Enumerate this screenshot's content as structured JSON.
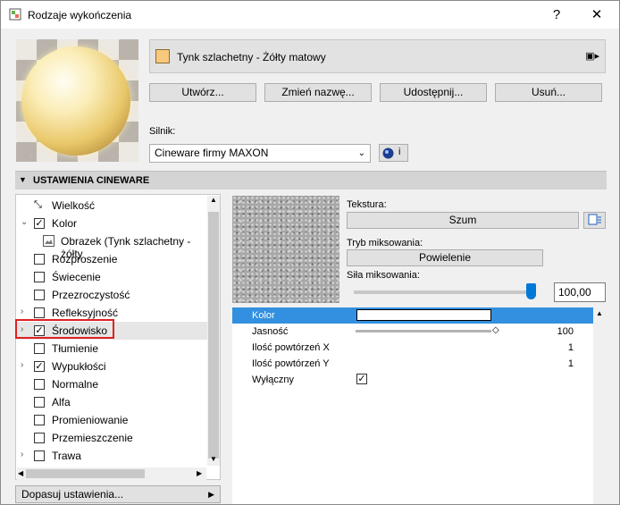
{
  "window": {
    "title": "Rodzaje wykończenia",
    "help": "?",
    "close": "✕"
  },
  "material": {
    "name": "Tynk szlachetny - Żółty matowy",
    "swatch_color": "#f8c97c"
  },
  "buttons": {
    "create": "Utwórz...",
    "rename": "Zmień nazwę...",
    "share": "Udostępnij...",
    "delete": "Usuń..."
  },
  "engine": {
    "label": "Silnik:",
    "value": "Cineware firmy MAXON",
    "info": "i"
  },
  "section": {
    "title": "USTAWIENIA CINEWARE"
  },
  "channels": [
    {
      "label": "Wielkość",
      "checked": null,
      "expand": ""
    },
    {
      "label": "Kolor",
      "checked": true,
      "expand": "⌄"
    },
    {
      "label": "Obrazek (Tynk szlachetny - żółty",
      "checked": null,
      "expand": ""
    },
    {
      "label": "Rozproszenie",
      "checked": false,
      "expand": ""
    },
    {
      "label": "Świecenie",
      "checked": false,
      "expand": ""
    },
    {
      "label": "Przezroczystość",
      "checked": false,
      "expand": ""
    },
    {
      "label": "Refleksyjność",
      "checked": false,
      "expand": "›"
    },
    {
      "label": "Środowisko",
      "checked": true,
      "expand": "›"
    },
    {
      "label": "Tłumienie",
      "checked": false,
      "expand": ""
    },
    {
      "label": "Wypukłości",
      "checked": true,
      "expand": "›"
    },
    {
      "label": "Normalne",
      "checked": false,
      "expand": ""
    },
    {
      "label": "Alfa",
      "checked": false,
      "expand": ""
    },
    {
      "label": "Promieniowanie",
      "checked": false,
      "expand": ""
    },
    {
      "label": "Przemieszczenie",
      "checked": false,
      "expand": ""
    },
    {
      "label": "Trawa",
      "checked": false,
      "expand": "›"
    }
  ],
  "footer": {
    "label": "Dopasuj ustawienia..."
  },
  "texture": {
    "label": "Tekstura:",
    "value": "Szum"
  },
  "blend": {
    "mode_label": "Tryb miksowania:",
    "mode_value": "Powielenie",
    "strength_label": "Siła miksowania:",
    "strength_value": "100,00"
  },
  "params": [
    {
      "label": "Kolor",
      "value": ""
    },
    {
      "label": "Jasność",
      "value": "100"
    },
    {
      "label": "Ilość powtórzeń X",
      "value": "1"
    },
    {
      "label": "Ilość powtórzeń Y",
      "value": "1"
    },
    {
      "label": "Wyłączny",
      "value": ""
    }
  ]
}
